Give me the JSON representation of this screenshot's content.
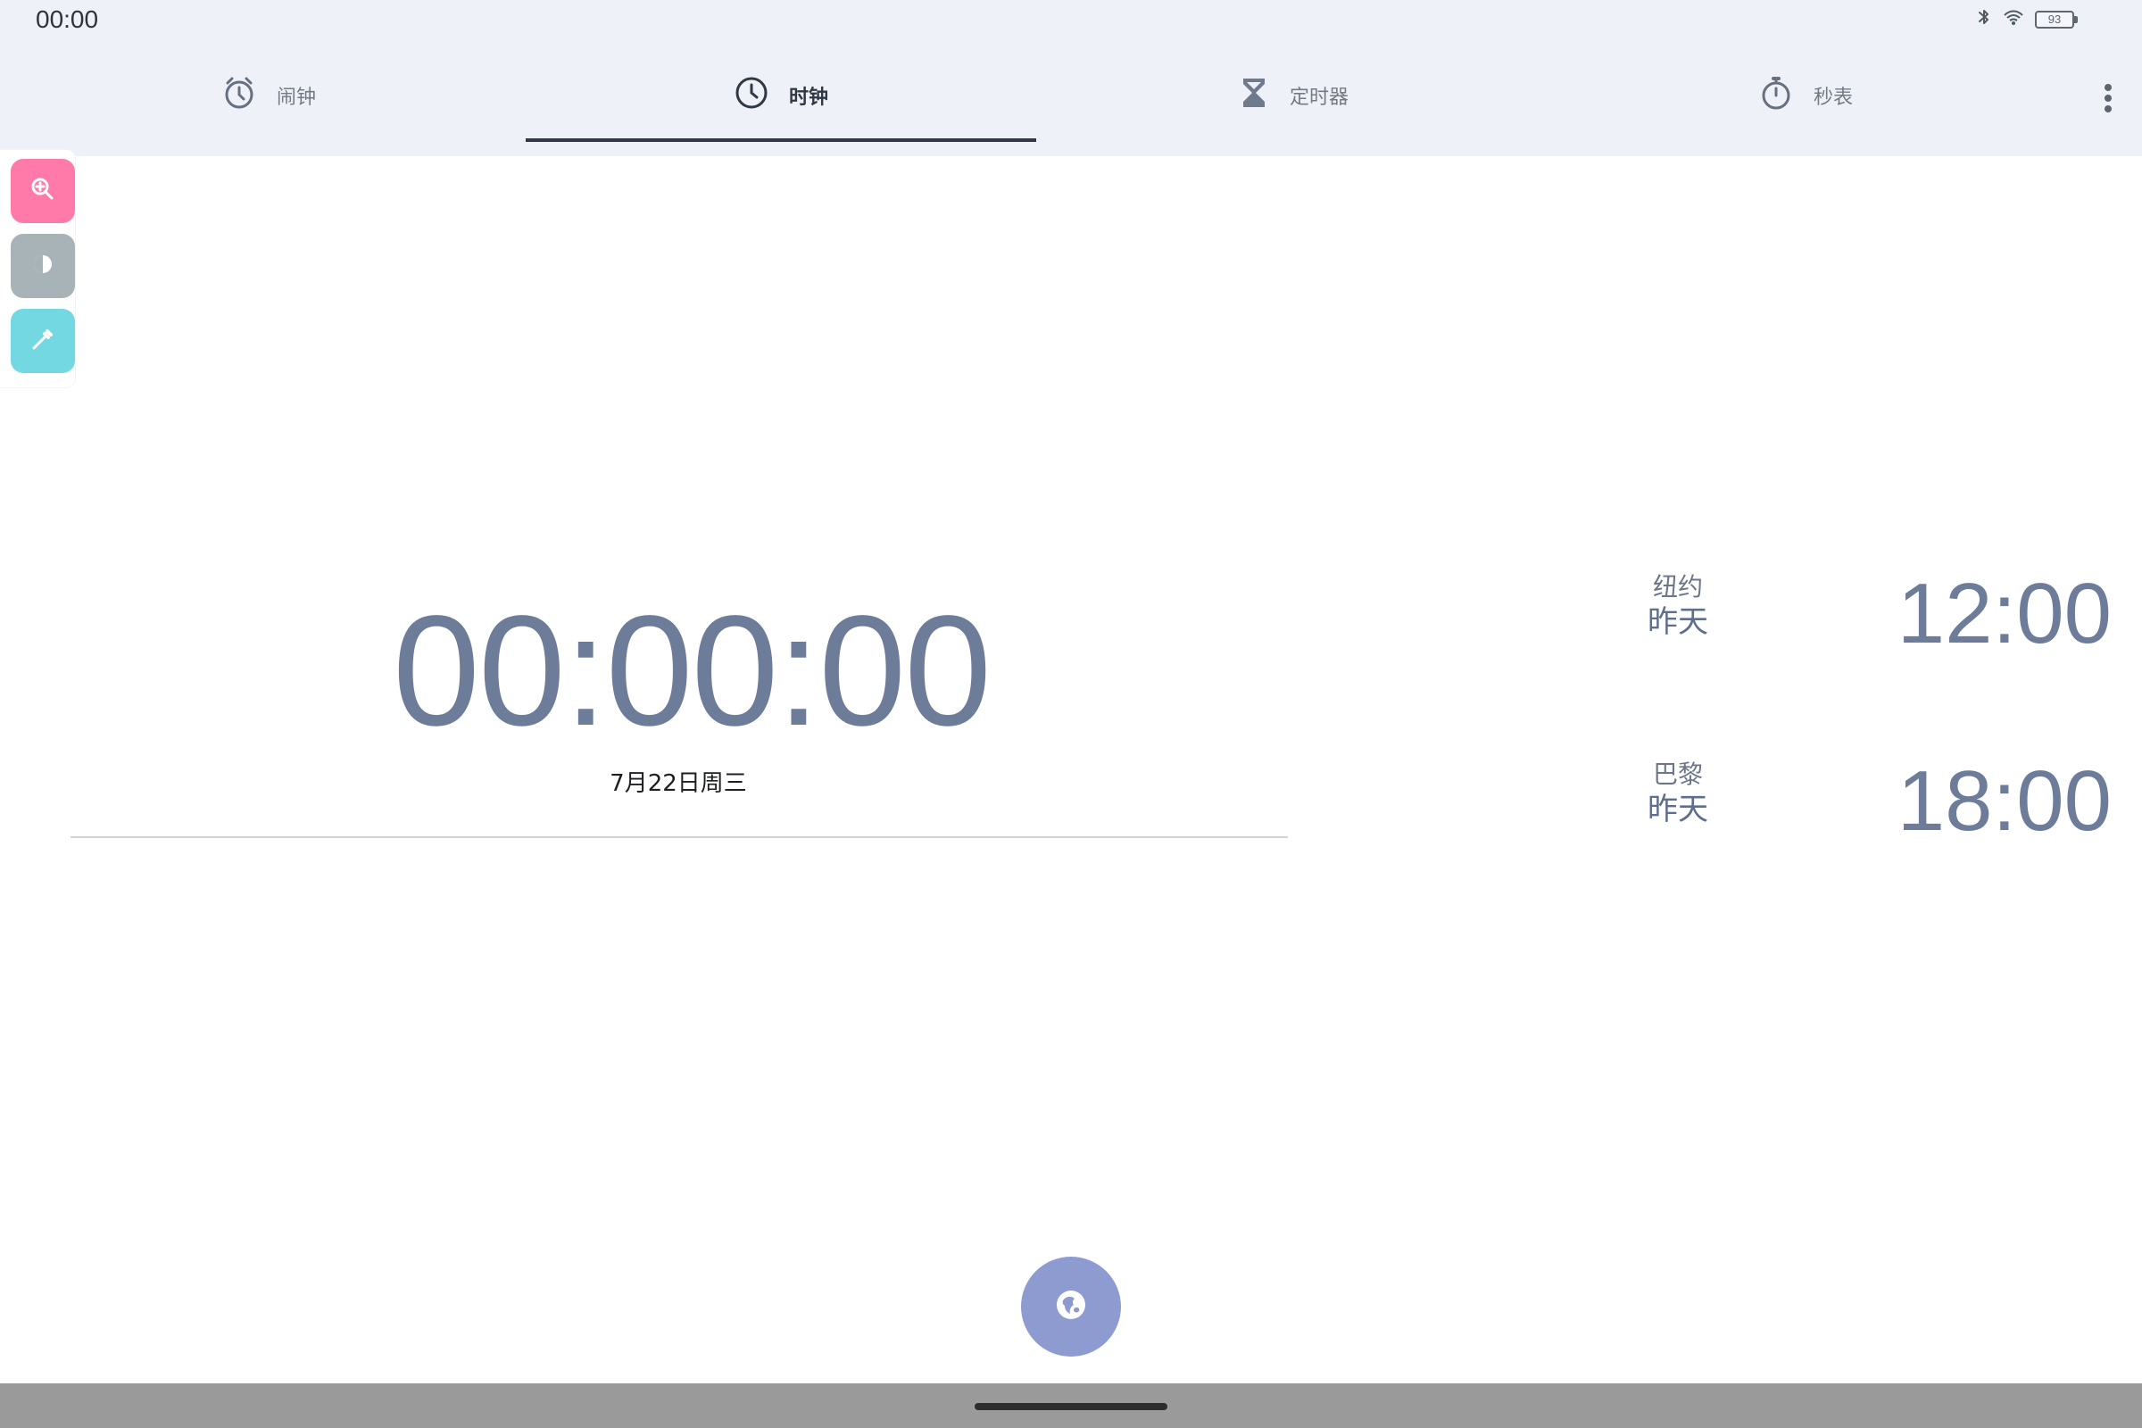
{
  "status_bar": {
    "time": "00:00",
    "battery": "93"
  },
  "tabs": [
    {
      "label": "闹钟",
      "icon": "alarm-icon"
    },
    {
      "label": "时钟",
      "icon": "clock-icon"
    },
    {
      "label": "定时器",
      "icon": "hourglass-icon"
    },
    {
      "label": "秒表",
      "icon": "stopwatch-icon"
    }
  ],
  "active_tab": "时钟",
  "clock": {
    "time": "00:00:00",
    "date": "7月22日周三"
  },
  "world_clocks": [
    {
      "city": "纽约",
      "day": "昨天",
      "time": "12:00"
    },
    {
      "city": "巴黎",
      "day": "昨天",
      "time": "18:00"
    }
  ],
  "tool_colors": {
    "zoom": "#ff7aa8",
    "contrast": "#a8b3b8",
    "picker": "#73d8e2"
  },
  "fab": {
    "icon": "globe-icon",
    "color": "#8d9bd0"
  }
}
